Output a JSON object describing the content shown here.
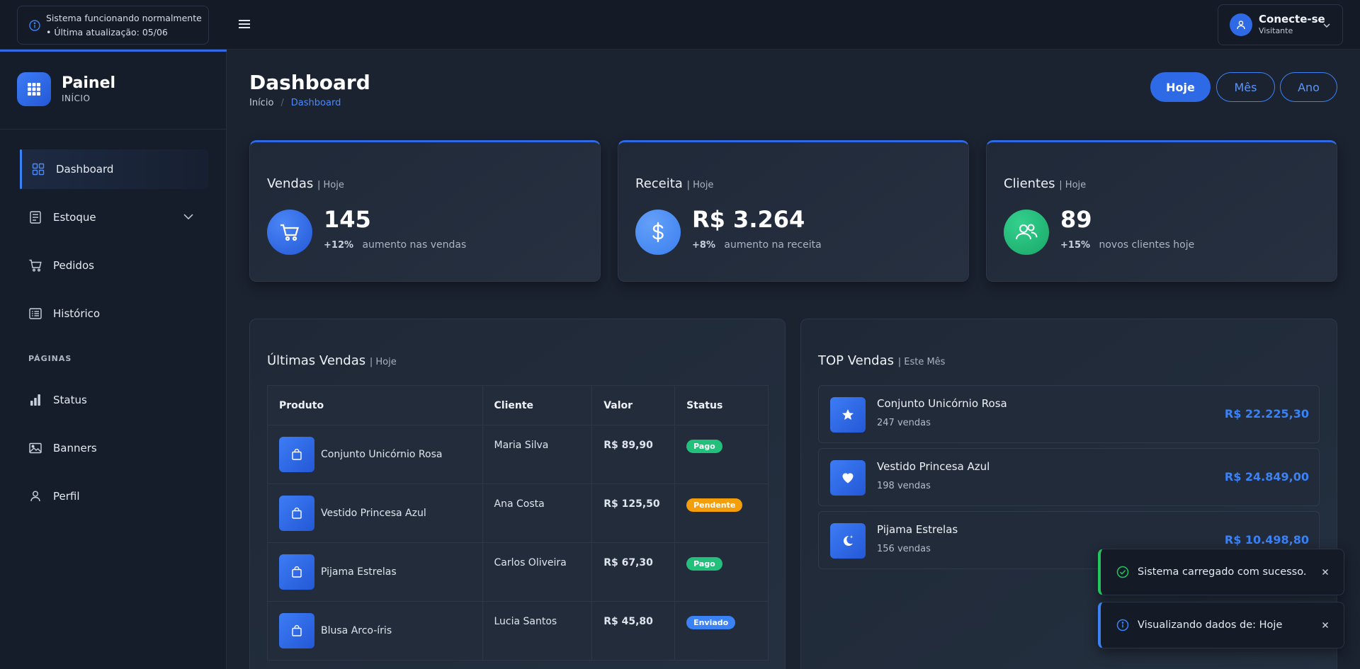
{
  "topbar": {
    "status_line1": "Sistema funcionando normalmente",
    "status_line2": "• Última atualização: 05/06",
    "user_name": "Conecte-se",
    "user_role": "Visitante"
  },
  "sidebar": {
    "brand_title": "Painel",
    "brand_subtitle": "INÍCIO",
    "section_label": "PÁGINAS",
    "items": [
      {
        "label": "Dashboard",
        "icon": "grid-icon"
      },
      {
        "label": "Estoque",
        "icon": "stock-icon"
      },
      {
        "label": "Pedidos",
        "icon": "cart-icon"
      },
      {
        "label": "Histórico",
        "icon": "list-icon"
      },
      {
        "label": "Status",
        "icon": "bar-chart-icon"
      },
      {
        "label": "Banners",
        "icon": "image-icon"
      },
      {
        "label": "Perfil",
        "icon": "user-icon"
      }
    ]
  },
  "page": {
    "title": "Dashboard",
    "breadcrumb": [
      "Início",
      "Dashboard"
    ],
    "periods": [
      "Hoje",
      "Mês",
      "Ano"
    ],
    "active_period": "Hoje"
  },
  "stats": [
    {
      "title": "Vendas",
      "period": "| Hoje",
      "value": "145",
      "pct": "+12%",
      "caption": "aumento nas vendas",
      "color": "#2f6ae6"
    },
    {
      "title": "Receita",
      "period": "| Hoje",
      "value": "R$ 3.264",
      "pct": "+8%",
      "caption": "aumento na receita",
      "color": "#3b82f6"
    },
    {
      "title": "Clientes",
      "period": "| Hoje",
      "value": "89",
      "pct": "+15%",
      "caption": "novos clientes hoje",
      "color": "#22c07a"
    }
  ],
  "latest_sales": {
    "title": "Últimas Vendas",
    "period": "| Hoje",
    "columns": [
      "Produto",
      "Cliente",
      "Valor",
      "Status"
    ],
    "rows": [
      {
        "product": "Conjunto Unicórnio Rosa",
        "client": "Maria Silva",
        "value": "R$ 89,90",
        "status": "Pago",
        "status_color": "#22c07a"
      },
      {
        "product": "Vestido Princesa Azul",
        "client": "Ana Costa",
        "value": "R$ 125,50",
        "status": "Pendente",
        "status_color": "#f59e0b"
      },
      {
        "product": "Pijama Estrelas",
        "client": "Carlos Oliveira",
        "value": "R$ 67,30",
        "status": "Pago",
        "status_color": "#22c07a"
      },
      {
        "product": "Blusa Arco-íris",
        "client": "Lucia Santos",
        "value": "R$ 45,80",
        "status": "Enviado",
        "status_color": "#3b82f6"
      }
    ]
  },
  "top_sales": {
    "title": "TOP Vendas",
    "period": "| Este Mês",
    "items": [
      {
        "name": "Conjunto Unicórnio Rosa",
        "count": "247 vendas",
        "value": "R$ 22.225,30",
        "icon": "star-icon"
      },
      {
        "name": "Vestido Princesa Azul",
        "count": "198 vendas",
        "value": "R$ 24.849,00",
        "icon": "heart-icon"
      },
      {
        "name": "Pijama Estrelas",
        "count": "156 vendas",
        "value": "R$ 10.498,80",
        "icon": "moon-icon"
      }
    ]
  },
  "toasts": [
    {
      "text": "Sistema carregado com sucesso.",
      "type": "success"
    },
    {
      "text": "Visualizando dados de: Hoje",
      "type": "info"
    }
  ],
  "colors": {
    "accent": "#2f6ae6",
    "success": "#22c07a",
    "warning": "#f59e0b",
    "info": "#3b82f6"
  }
}
